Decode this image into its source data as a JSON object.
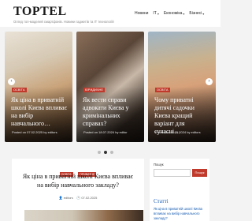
{
  "site": {
    "logo": "TOPTEL",
    "tagline": "Огляд топ-моделей смартфонів. Новини гаджетів та IT технологій"
  },
  "nav": [
    {
      "label": "Новини"
    },
    {
      "label": "IT",
      "chevron": "▾"
    },
    {
      "label": "Економіка",
      "chevron": "▾"
    },
    {
      "label": "Бізнесі",
      "chevron": "▾"
    }
  ],
  "slider": {
    "prev_icon": "‹",
    "next_icon": "›",
    "slides": [
      {
        "category": "ОСВІТА",
        "title": "Як ціна в приватній школі Києва впливає на вибір навчального…",
        "meta": "Posted on 07.02.2025 by editors"
      },
      {
        "category": "ЮРИДИЧНЕ",
        "category2": "",
        "title": "Як вести справи адвокати Києва у кримінальних справах?",
        "meta": "Posted on 18.07.2024 by editor"
      },
      {
        "category": "ОСВІТА",
        "title": "Чому приватні дитячі садочки Києва кращий варіант для сучасні…",
        "meta": "Posted on 28.05.2024 by editors"
      }
    ],
    "dots": [
      false,
      true,
      false
    ]
  },
  "post": {
    "categories": [
      "ОСВІТА",
      "ПРИВАТНЕ"
    ],
    "title": "Як ціна в приватній школі Києва впливає на вибір навчального закладу?",
    "author": "editors",
    "date": "07.02.2025"
  },
  "sidebar": {
    "search_label": "Пошук",
    "search_button": "Пошук",
    "section_title": "Статті",
    "links": [
      "Як ціна в приватній школі Києва",
      "впливає на вибір навчального",
      "закладу?"
    ]
  }
}
